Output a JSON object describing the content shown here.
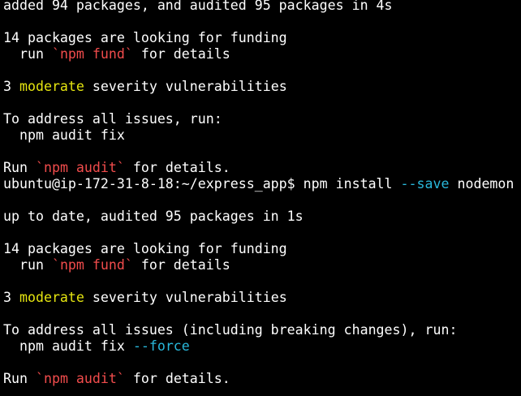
{
  "colors": {
    "background": "#000000",
    "foreground": "#ffffff",
    "red": "#f14c4c",
    "yellow": "#e5e510",
    "cyan": "#29b8db"
  },
  "lines": [
    [
      {
        "t": "added 94 packages, and audited 95 packages in 4s",
        "c": ""
      }
    ],
    [],
    [
      {
        "t": "14 packages are looking for funding",
        "c": ""
      }
    ],
    [
      {
        "t": "  run ",
        "c": ""
      },
      {
        "t": "`npm fund`",
        "c": "red"
      },
      {
        "t": " for details",
        "c": ""
      }
    ],
    [],
    [
      {
        "t": "3 ",
        "c": ""
      },
      {
        "t": "moderate",
        "c": "yellow"
      },
      {
        "t": " severity vulnerabilities",
        "c": ""
      }
    ],
    [],
    [
      {
        "t": "To address all issues, run:",
        "c": ""
      }
    ],
    [
      {
        "t": "  npm audit fix",
        "c": ""
      }
    ],
    [],
    [
      {
        "t": "Run ",
        "c": ""
      },
      {
        "t": "`npm audit`",
        "c": "red"
      },
      {
        "t": " for details.",
        "c": ""
      }
    ],
    [
      {
        "t": "ubuntu@ip-172-31-8-18:~/express_app$ npm install ",
        "c": ""
      },
      {
        "t": "--save",
        "c": "cyan"
      },
      {
        "t": " nodemon",
        "c": ""
      }
    ],
    [],
    [
      {
        "t": "up to date, audited 95 packages in 1s",
        "c": ""
      }
    ],
    [],
    [
      {
        "t": "14 packages are looking for funding",
        "c": ""
      }
    ],
    [
      {
        "t": "  run ",
        "c": ""
      },
      {
        "t": "`npm fund`",
        "c": "red"
      },
      {
        "t": " for details",
        "c": ""
      }
    ],
    [],
    [
      {
        "t": "3 ",
        "c": ""
      },
      {
        "t": "moderate",
        "c": "yellow"
      },
      {
        "t": " severity vulnerabilities",
        "c": ""
      }
    ],
    [],
    [
      {
        "t": "To address all issues (including breaking changes), run:",
        "c": ""
      }
    ],
    [
      {
        "t": "  npm audit fix ",
        "c": ""
      },
      {
        "t": "--force",
        "c": "cyan"
      }
    ],
    [],
    [
      {
        "t": "Run ",
        "c": ""
      },
      {
        "t": "`npm audit`",
        "c": "red"
      },
      {
        "t": " for details.",
        "c": ""
      }
    ]
  ]
}
